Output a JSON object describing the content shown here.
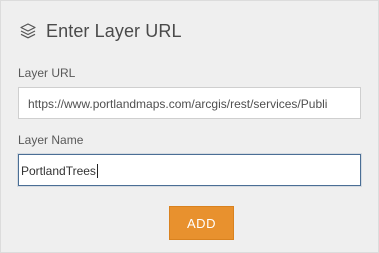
{
  "header": {
    "icon": "layers-icon",
    "title": "Enter Layer URL"
  },
  "form": {
    "url_label": "Layer URL",
    "url_value": "https://www.portlandmaps.com/arcgis/rest/services/Publi",
    "name_label": "Layer Name",
    "name_value": "PortlandTrees",
    "add_label": "ADD"
  },
  "colors": {
    "panel_bg": "#efefef",
    "accent_button": "#e8912e",
    "focus_border": "#4a6e95"
  }
}
